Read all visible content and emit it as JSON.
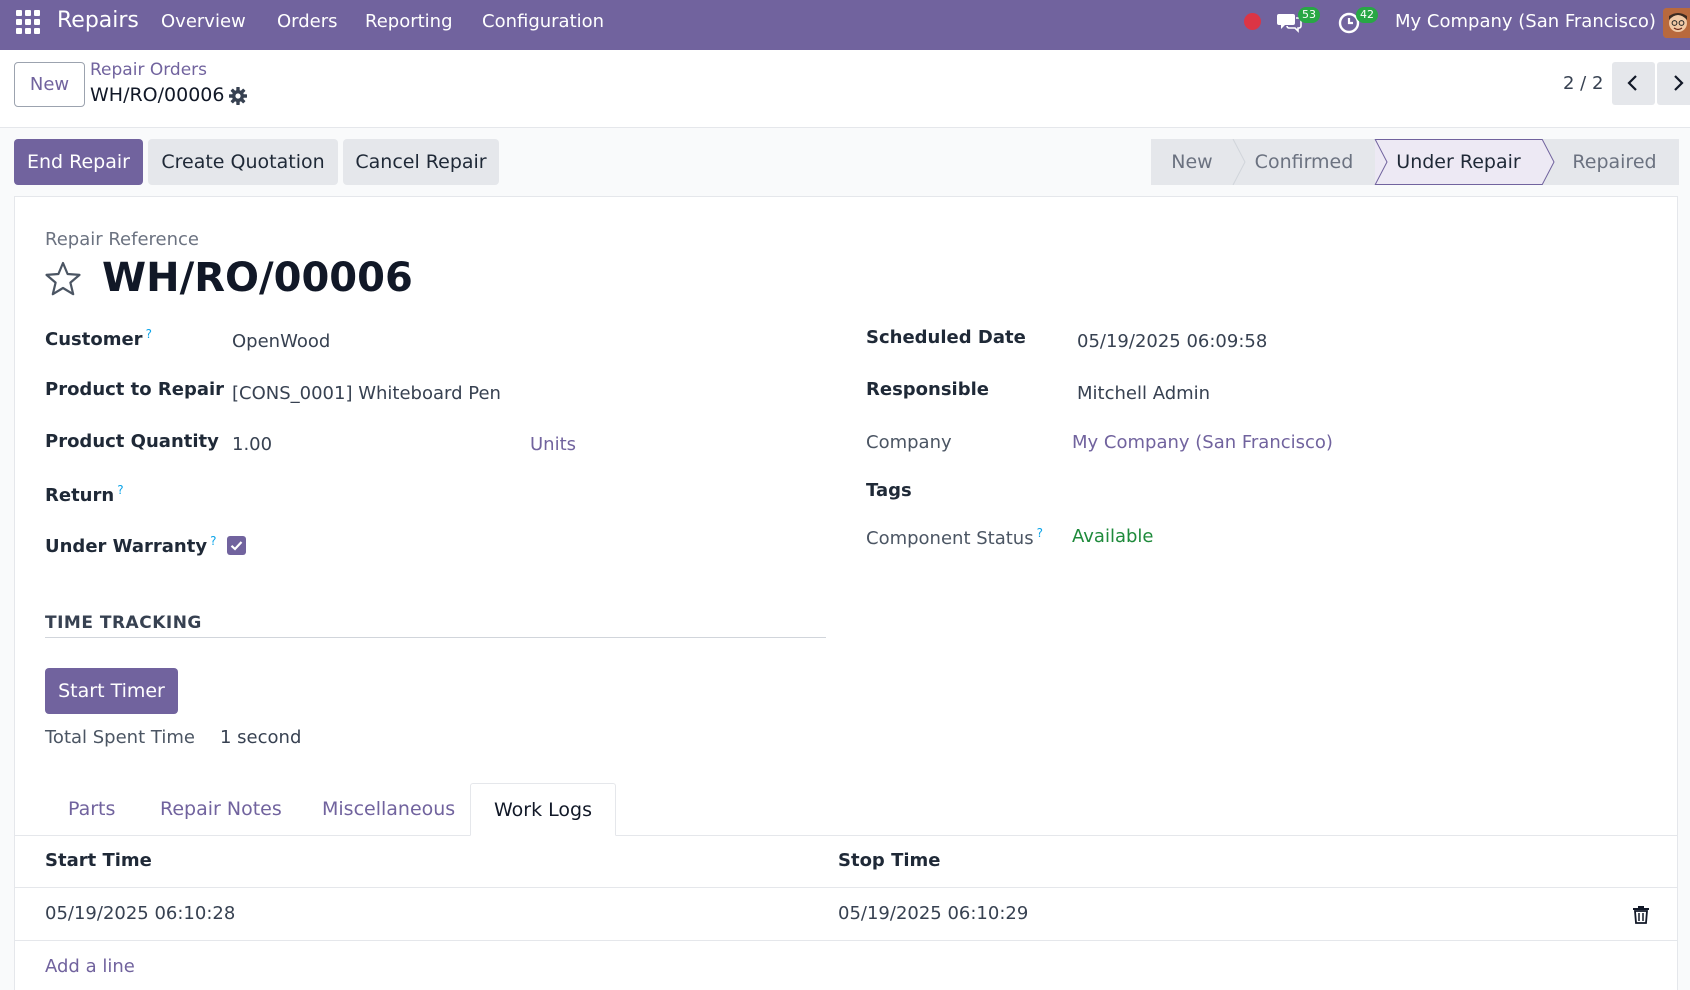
{
  "nav": {
    "app_name": "Repairs",
    "menu": [
      "Overview",
      "Orders",
      "Reporting",
      "Configuration"
    ],
    "messages_count": "53",
    "activities_count": "42",
    "company": "My Company (San Francisco)",
    "icons": {
      "apps": "apps-grid-icon",
      "record": "record-dot-icon",
      "messages": "chat-icon",
      "activities": "clock-icon",
      "avatar": "user-avatar"
    },
    "colors": {
      "brand": "#71639e",
      "record": "#dc3545",
      "badge": "#28a745"
    }
  },
  "control_panel": {
    "new_label": "New",
    "breadcrumb_parent": "Repair Orders",
    "breadcrumb_current": "WH/RO/00006",
    "pager_value": "2 / 2"
  },
  "actions": {
    "end_repair": "End Repair",
    "create_quotation": "Create Quotation",
    "cancel_repair": "Cancel Repair"
  },
  "statusbar": {
    "stages": [
      "New",
      "Confirmed",
      "Under Repair",
      "Repaired"
    ],
    "active": "Under Repair"
  },
  "form": {
    "ref_label": "Repair Reference",
    "ref_value": "WH/RO/00006",
    "help_marker": "?",
    "left": {
      "customer_label": "Customer",
      "customer_value": "OpenWood",
      "product_label": "Product to Repair",
      "product_value": "[CONS_0001] Whiteboard Pen",
      "quantity_label": "Product Quantity",
      "quantity_value": "1.00",
      "quantity_uom": "Units",
      "return_label": "Return",
      "warranty_label": "Under Warranty",
      "warranty_checked": true
    },
    "right": {
      "scheduled_label": "Scheduled Date",
      "scheduled_value": "05/19/2025 06:09:58",
      "responsible_label": "Responsible",
      "responsible_value": "Mitchell Admin",
      "company_label": "Company",
      "company_value": "My Company (San Francisco)",
      "tags_label": "Tags",
      "component_label": "Component Status",
      "component_value": "Available"
    },
    "time_tracking": {
      "title": "TIME TRACKING",
      "start_timer": "Start Timer",
      "total_label": "Total Spent Time",
      "total_value": "1 second"
    }
  },
  "tabs": {
    "items": [
      "Parts",
      "Repair Notes",
      "Miscellaneous",
      "Work Logs"
    ],
    "active": "Work Logs"
  },
  "worklogs": {
    "columns": [
      "Start Time",
      "Stop Time"
    ],
    "rows": [
      {
        "start": "05/19/2025 06:10:28",
        "stop": "05/19/2025 06:10:29"
      }
    ],
    "add_line": "Add a line"
  }
}
